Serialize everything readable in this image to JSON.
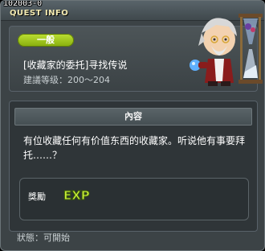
{
  "window": {
    "quest_id": "102003-0",
    "title": "QUEST INFO"
  },
  "header": {
    "category": "一般",
    "quest_name": "[收藏家的委托]寻找传说",
    "level_label": "建議等级：",
    "level_range": "200～204"
  },
  "body": {
    "section_title": "內容",
    "description": "有位收藏任何有价值东西的收藏家。听说他有事要拜托……？"
  },
  "reward": {
    "label": "獎勵",
    "icon": "exp-icon",
    "icon_text": "EXP"
  },
  "status": {
    "text": "狀態：可開始"
  },
  "colors": {
    "badge_green": "#a3cd22",
    "title_text": "#f2e9b0",
    "exp_text": "#c8ee3a"
  }
}
